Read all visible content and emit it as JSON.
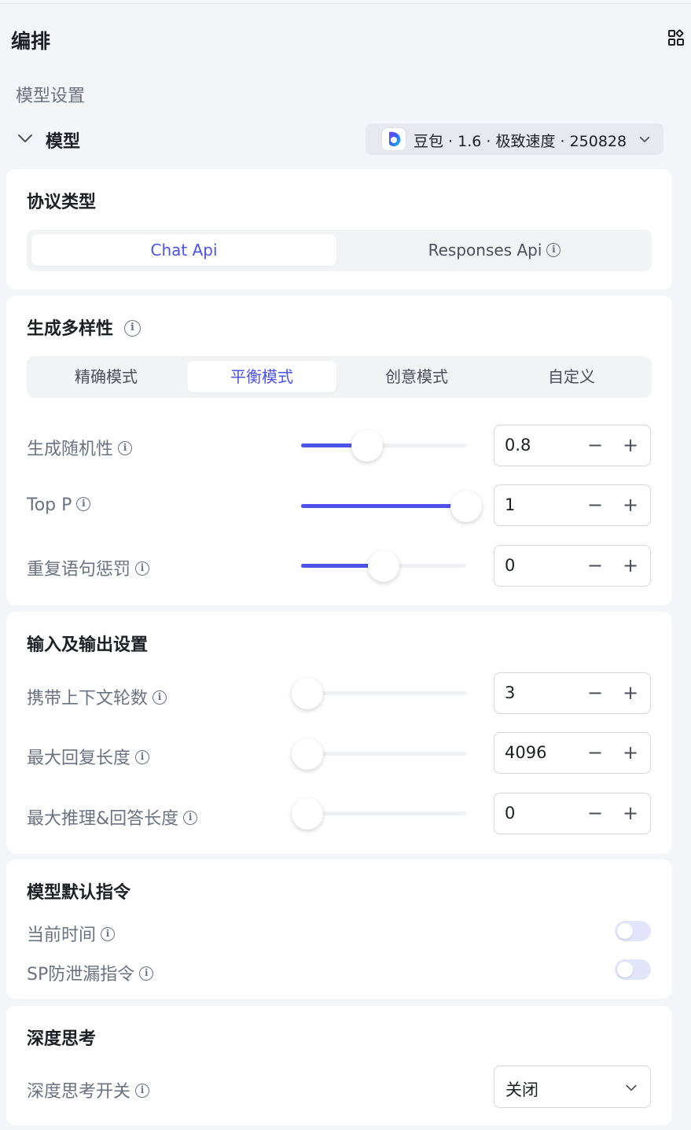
{
  "header": {
    "title": "编排",
    "grid_icon": "grid-add-icon"
  },
  "section_label": "模型设置",
  "model": {
    "label": "模型",
    "selected": "豆包 · 1.6 · 极致速度 · 250828"
  },
  "protocol": {
    "title": "协议类型",
    "options": [
      "Chat Api",
      "Responses Api"
    ],
    "active_index": 0
  },
  "diversity": {
    "title": "生成多样性",
    "modes": [
      "精确模式",
      "平衡模式",
      "创意模式",
      "自定义"
    ],
    "active_index": 1,
    "params": [
      {
        "label": "生成随机性",
        "value": "0.8",
        "level": 0.4
      },
      {
        "label": "Top P",
        "value": "1",
        "level": 1.0
      },
      {
        "label": "重复语句惩罚",
        "value": "0",
        "level": 0.5
      }
    ]
  },
  "io": {
    "title": "输入及输出设置",
    "params": [
      {
        "label": "携带上下文轮数",
        "value": "3",
        "level": 0.0
      },
      {
        "label": "最大回复长度",
        "value": "4096",
        "level": 0.03
      },
      {
        "label": "最大推理&回答长度",
        "value": "0",
        "level": 0.0
      }
    ]
  },
  "default_instructions": {
    "title": "模型默认指令",
    "items": [
      {
        "label": "当前时间",
        "on": false
      },
      {
        "label": "SP防泄漏指令",
        "on": false
      }
    ]
  },
  "deep_thinking": {
    "title": "深度思考",
    "switch_label": "深度思考开关",
    "value": "关闭"
  },
  "colors": {
    "accent": "#4d53e8",
    "background": "#f4f5f8",
    "card": "#ffffff"
  }
}
